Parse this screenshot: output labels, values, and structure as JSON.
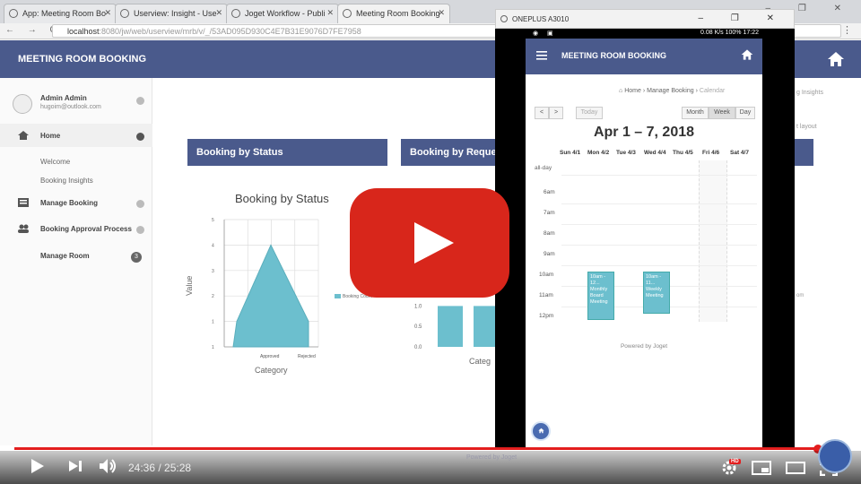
{
  "browser": {
    "tabs": [
      {
        "title": "App: Meeting Room Bo"
      },
      {
        "title": "Userview: Insight - Use"
      },
      {
        "title": "Joget Workflow - Publi"
      },
      {
        "title": "Meeting Room Booking"
      }
    ],
    "url_host": "localhost",
    "url_rest": ":8080/jw/web/userview/mrb/v/_/53AD095D930C4E7B31E9076D7FE7958",
    "window_controls": "– ❐ ✕",
    "nav": "← → C"
  },
  "app": {
    "title": "MEETING ROOM BOOKING",
    "user": {
      "name": "Admin Admin",
      "email": "hugoim@outlook.com"
    },
    "sidebar": {
      "home": "Home",
      "welcome": "Welcome",
      "insights": "Booking Insights",
      "manage_booking": "Manage Booking",
      "approval": "Booking Approval Process",
      "manage_room": "Manage Room",
      "manage_room_badge": "3"
    },
    "panels": {
      "status": "Booking by Status",
      "request": "Booking by Reque"
    },
    "right_fragments": {
      "a": "g Insights",
      "b": "t layout",
      "c": "om"
    }
  },
  "chart_data": [
    {
      "type": "area",
      "title": "Booking by Status",
      "xlabel": "Category",
      "ylabel": "Value",
      "categories": [
        "Approved",
        "Rejected"
      ],
      "yticks": [
        "1",
        "1",
        "2",
        "3",
        "4",
        "5"
      ],
      "ylim": [
        0,
        5
      ],
      "series": [
        {
          "name": "Booking Count",
          "values": [
            4,
            1
          ]
        }
      ]
    },
    {
      "type": "bar",
      "xlabel": "Categ",
      "yticks": [
        "0.0",
        "0.5",
        "1.0"
      ],
      "ylim": [
        0,
        1.25
      ],
      "values": [
        1,
        1
      ]
    }
  ],
  "phone": {
    "window_title": "ONEPLUS A3010",
    "status_right": "0.08 K/s  100%  17:22",
    "header": "MEETING ROOM BOOKING",
    "breadcrumb": {
      "home": "Home",
      "manage": "Manage Booking",
      "current": "Calendar"
    },
    "buttons": {
      "prev": "<",
      "next": ">",
      "today": "Today",
      "month": "Month",
      "week": "Week",
      "day": "Day"
    },
    "cal_title": "Apr 1 – 7, 2018",
    "days": [
      "Sun 4/1",
      "Mon 4/2",
      "Tue 4/3",
      "Wed 4/4",
      "Thu 4/5",
      "Fri 4/6",
      "Sat 4/7"
    ],
    "allday": "all-day",
    "times": [
      "6am",
      "7am",
      "8am",
      "9am",
      "10am",
      "11am",
      "12pm"
    ],
    "events": [
      {
        "label": "10am - 12... Monthly Board Meeting"
      },
      {
        "label": "10am - 11... Weekly Meeting"
      }
    ],
    "powered": "Powered by Joget"
  },
  "player": {
    "time": "24:36 / 25:28",
    "progress": 0.966,
    "hd": "HD",
    "powered_bottom": "Powered by Joget",
    "colors": {
      "progress": "#e31e1e",
      "play_button": "#d8261b"
    }
  }
}
